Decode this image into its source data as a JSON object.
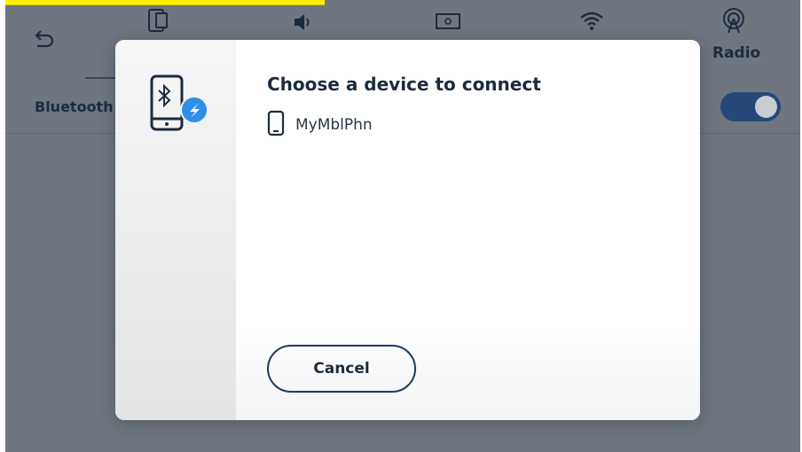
{
  "background": {
    "tabs": [
      {
        "icon": "phone-device-icon"
      },
      {
        "icon": "speaker-icon"
      },
      {
        "icon": "display-settings-icon"
      },
      {
        "icon": "wifi-icon"
      },
      {
        "icon": "radio-antenna-icon",
        "label": "Radio"
      }
    ],
    "row_label": "Bluetooth",
    "toggle_on": true
  },
  "dialog": {
    "title": "Choose a device to connect",
    "devices": [
      {
        "name": "MyMblPhn",
        "icon": "smartphone-icon"
      }
    ],
    "cancel_label": "Cancel"
  },
  "colors": {
    "primary": "#1d2b3d",
    "button_border": "#1e3a5f",
    "accent_blue": "#2f8ee8",
    "overlay": "#6f7680",
    "toggle": "#254878"
  }
}
